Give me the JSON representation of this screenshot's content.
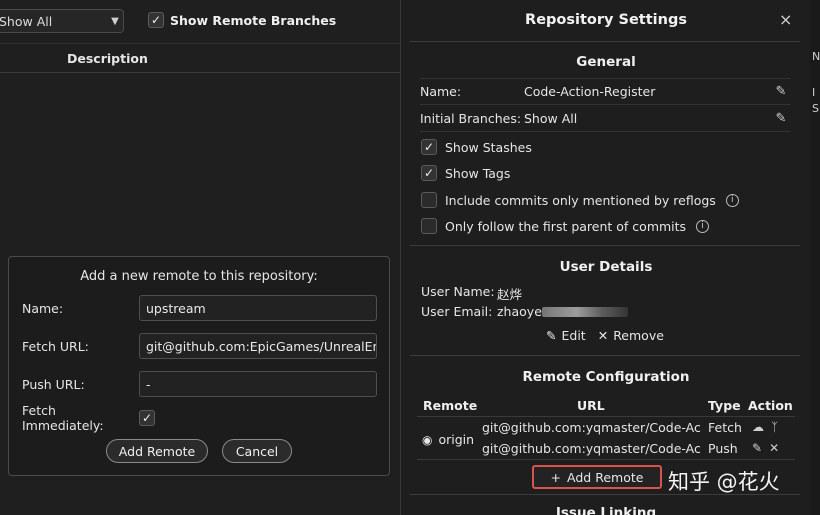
{
  "toolbar": {
    "branch_filter": "Show All",
    "show_remote_branches_label": "Show Remote Branches",
    "show_remote_branches_checked": true
  },
  "table": {
    "description_header": "Description"
  },
  "add_remote_form": {
    "title": "Add a new remote to this repository:",
    "name_label": "Name:",
    "name_value": "upstream",
    "fetch_url_label": "Fetch URL:",
    "fetch_url_value": "git@github.com:EpicGames/UnrealEngi",
    "push_url_label": "Push URL:",
    "push_url_value": "-",
    "fetch_immediately_label": "Fetch Immediately:",
    "fetch_immediately_checked": true,
    "add_button": "Add Remote",
    "cancel_button": "Cancel"
  },
  "settings": {
    "title": "Repository Settings",
    "close_icon": "×",
    "general": {
      "title": "General",
      "name_label": "Name:",
      "name_value": "Code-Action-Register",
      "initial_branches_label": "Initial Branches:",
      "initial_branches_value": "Show All",
      "show_stashes": "Show Stashes",
      "show_tags": "Show Tags",
      "include_reflogs": "Include commits only mentioned by reflogs",
      "first_parent": "Only follow the first parent of commits"
    },
    "user_details": {
      "title": "User Details",
      "user_name_label": "User Name:",
      "user_name_value": "赵烨",
      "user_email_label": "User Email:",
      "user_email_value": "zhaoye",
      "edit": "Edit",
      "remove": "Remove"
    },
    "remote_config": {
      "title": "Remote Configuration",
      "headers": {
        "remote": "Remote",
        "url": "URL",
        "type": "Type",
        "action": "Action"
      },
      "remote_name": "origin",
      "fetch_url": "git@github.com:yqmaster/Code-Ac...",
      "fetch_type": "Fetch",
      "push_url": "git@github.com:yqmaster/Code-Ac...",
      "push_type": "Push",
      "add_remote": "Add Remote"
    },
    "issue_linking": {
      "title": "Issue Linking"
    }
  },
  "watermark": "知乎 @花火",
  "right_edge": [
    "N",
    "I",
    "S"
  ]
}
